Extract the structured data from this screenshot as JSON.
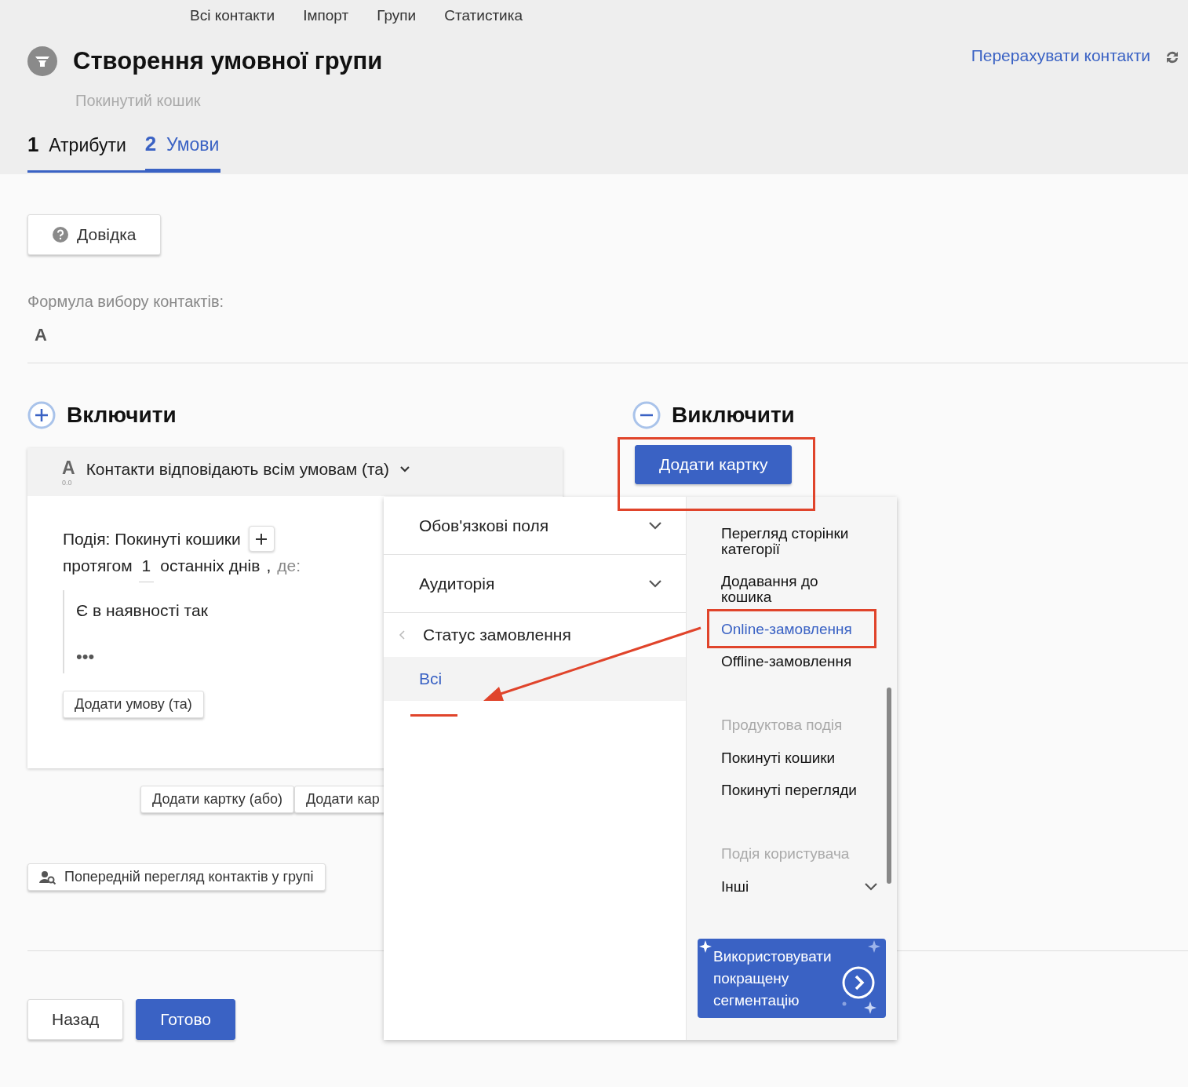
{
  "top_nav": [
    {
      "label": "Всі контакти"
    },
    {
      "label": "Імпорт"
    },
    {
      "label": "Групи"
    },
    {
      "label": "Статистика"
    }
  ],
  "header": {
    "title": "Створення умовної групи",
    "subtitle": "Покинутий кошик",
    "recalculate_link": "Перерахувати контакти"
  },
  "steps": [
    {
      "number": "1",
      "label": "Атрибути",
      "selected": false
    },
    {
      "number": "2",
      "label": "Умови",
      "selected": true
    }
  ],
  "help_button": "Довідка",
  "formula": {
    "label": "Формула вибору контактів:",
    "value": "A"
  },
  "include": {
    "heading": "Включити",
    "card": {
      "letter": "A",
      "index": "0.0",
      "match_label": "Контакти відповідають всім умовам (та)",
      "event_label": "Подія: Покинуті кошики",
      "period_prefix": "протягом",
      "period_value": "1",
      "period_suffix": "останніх днів",
      "comma": ",",
      "where": "де:",
      "condition": "Є в наявності так",
      "more": "•••",
      "add_condition_button": "Додати умову (та)"
    },
    "add_card_or_button": "Додати картку (або)",
    "add_card_and_button": "Додати кар"
  },
  "preview_button": "Попередній перегляд контактів у групі",
  "exclude": {
    "heading": "Виключити",
    "add_card_button": "Додати картку"
  },
  "dropdown": {
    "categories": [
      {
        "kind": "expandable",
        "label": "Обов'язкові поля"
      },
      {
        "kind": "expandable",
        "label": "Аудиторія"
      },
      {
        "kind": "back",
        "label": "Статус замовлення"
      }
    ],
    "options": [
      {
        "label": "Всі",
        "selected": true
      }
    ],
    "events": [
      {
        "kind": "item",
        "label": "Перегляд сторінки категорії",
        "selected": false
      },
      {
        "kind": "item",
        "label": "Додавання до кошика",
        "selected": false
      },
      {
        "kind": "item",
        "label": "Online-замовлення",
        "selected": true
      },
      {
        "kind": "item",
        "label": "Offline-замовлення",
        "selected": false
      },
      {
        "kind": "heading",
        "label": "Продуктова подія"
      },
      {
        "kind": "item",
        "label": "Покинуті кошики",
        "selected": false
      },
      {
        "kind": "item",
        "label": "Покинуті перегляди",
        "selected": false
      },
      {
        "kind": "heading",
        "label": "Подія користувача"
      },
      {
        "kind": "expandable",
        "label": "Інші",
        "selected": false
      }
    ],
    "promo": "Використовувати покращену сегментацію"
  },
  "footer_buttons": [
    {
      "kind": "secondary",
      "label": "Назад"
    },
    {
      "kind": "primary",
      "label": "Готово"
    }
  ]
}
